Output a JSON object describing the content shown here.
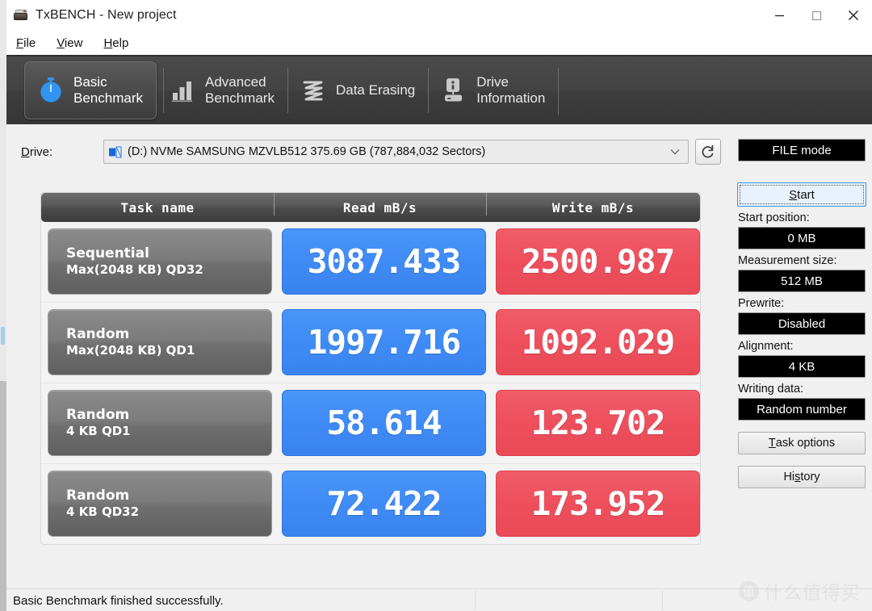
{
  "window": {
    "title": "TxBENCH - New project",
    "icon": "drive-icon",
    "controls": {
      "minimize": "minimize-icon",
      "maximize": "maximize-icon",
      "close": "close-icon"
    }
  },
  "menu": {
    "items": [
      {
        "accel": "F",
        "rest": "ile"
      },
      {
        "accel": "V",
        "rest": "iew"
      },
      {
        "accel": "H",
        "rest": "elp"
      }
    ]
  },
  "tabs": [
    {
      "label": "Basic\nBenchmark",
      "icon": "stopwatch-icon",
      "active": true
    },
    {
      "label": "Advanced\nBenchmark",
      "icon": "bar-chart-icon",
      "active": false
    },
    {
      "label": "Data Erasing",
      "icon": "shredder-icon",
      "active": false
    },
    {
      "label": "Drive\nInformation",
      "icon": "drive-info-icon",
      "active": false
    }
  ],
  "drive": {
    "label_accel": "D",
    "label_rest": "rive:",
    "selected": "(D:) NVMe SAMSUNG MZVLB512  375.69 GB (787,884,032 Sectors)",
    "icon": "drive-small-icon",
    "dropdown_icon": "chevron-down-icon",
    "refresh_icon": "refresh-icon"
  },
  "results": {
    "columns": [
      "Task name",
      "Read mB/s",
      "Write mB/s"
    ],
    "rows": [
      {
        "name": "Sequential",
        "detail": "Max(2048 KB) QD32",
        "read": "3087.433",
        "write": "2500.987"
      },
      {
        "name": "Random",
        "detail": "Max(2048 KB) QD1",
        "read": "1997.716",
        "write": "1092.029"
      },
      {
        "name": "Random",
        "detail": "4 KB QD1",
        "read": "58.614",
        "write": "123.702"
      },
      {
        "name": "Random",
        "detail": "4 KB QD32",
        "read": "72.422",
        "write": "173.952"
      }
    ]
  },
  "side": {
    "mode": "FILE mode",
    "start_accel": "S",
    "start_rest": "tart",
    "start_position_label": "Start position:",
    "start_position_value": "0 MB",
    "measurement_size_label": "Measurement size:",
    "measurement_size_value": "512 MB",
    "prewrite_label": "Prewrite:",
    "prewrite_value": "Disabled",
    "alignment_label": "Alignment:",
    "alignment_value": "4 KB",
    "writing_data_label": "Writing data:",
    "writing_data_value": "Random number",
    "task_options_accel": "T",
    "task_options_rest": "ask options",
    "history_pre": "Hi",
    "history_accel": "s",
    "history_rest": "tory"
  },
  "status": {
    "message": "Basic Benchmark finished successfully."
  },
  "watermark": {
    "badge": "值",
    "text": "什么值得买"
  },
  "colors": {
    "read_blue": "#3f8bf5",
    "write_red": "#ee4f5d",
    "tab_bg": "#434343",
    "accent": "#3a93e0"
  }
}
